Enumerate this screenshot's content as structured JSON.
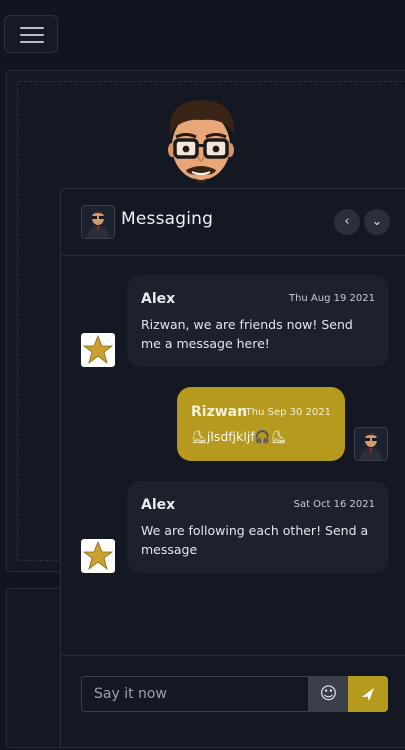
{
  "header": {
    "menu_icon": "hamburger-menu-icon"
  },
  "messaging": {
    "title": "Messaging",
    "prev_icon": "chevron-left-icon",
    "collapse_icon": "chevron-down-icon",
    "messages": [
      {
        "name": "Alex",
        "date": "Thu Aug 19 2021",
        "text": "Rizwan, we are friends now! Send me a message here!",
        "direction": "incoming"
      },
      {
        "name": "Rizwan",
        "date": "Thu Sep 30 2021",
        "text": "⛸jlsdfjkljf🎧⛸",
        "direction": "outgoing"
      },
      {
        "name": "Alex",
        "date": "Sat Oct 16 2021",
        "text": "We are following each other! Send a message",
        "direction": "incoming"
      }
    ],
    "composer": {
      "placeholder": "Say it now",
      "emoji_icon": "smiley-icon",
      "send_icon": "send-icon"
    }
  },
  "colors": {
    "background": "#121520",
    "panel": "#141823",
    "incoming_bubble": "#1d212c",
    "outgoing_bubble": "#b59a1e",
    "accent": "#b59a1e"
  }
}
